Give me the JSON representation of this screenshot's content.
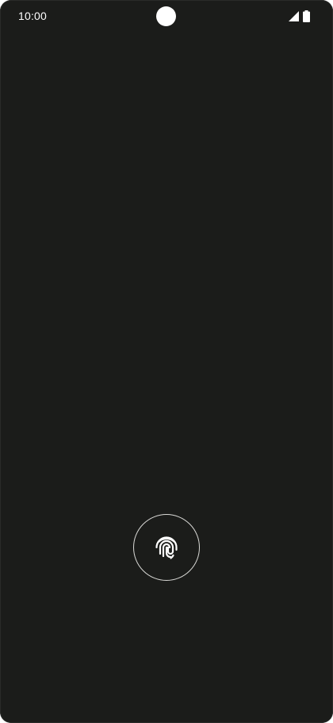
{
  "status_bar": {
    "time": "10:00",
    "icons": [
      "signal-icon",
      "battery-icon"
    ]
  },
  "lock_screen": {
    "unlock_icon": "fingerprint-icon"
  },
  "colors": {
    "background": "#1b1c1a",
    "foreground": "#ffffff",
    "ring": "#d9d9d6"
  }
}
